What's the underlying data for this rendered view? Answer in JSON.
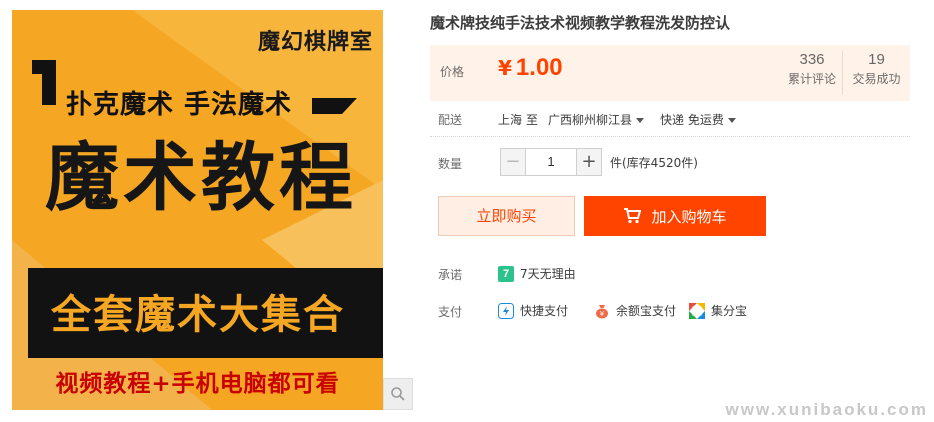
{
  "image": {
    "brand": "魔幻棋牌室",
    "headline_top": "扑克魔术  手法魔术",
    "headline_main": "魔术教程",
    "box_text": "全套魔术大集合",
    "bottom_text": "视频教程+手机电脑都可看",
    "zoom_icon": "magnifier-icon"
  },
  "product": {
    "title": "魔术牌技纯手法技术视频教学教程洗发防控认",
    "price_label": "价格",
    "currency": "¥",
    "price": "1.00",
    "reviews_count": "336",
    "reviews_label": "累计评论",
    "sold_count": "19",
    "sold_label": "交易成功"
  },
  "shipping": {
    "label": "配送",
    "from": "上海",
    "to_word": "至",
    "destination": "广西柳州柳江县",
    "method": "快递 免运费"
  },
  "quantity": {
    "label": "数量",
    "value": "1",
    "minus": "−",
    "plus": "+",
    "stock": "件(库存4520件)"
  },
  "actions": {
    "buy_now": "立即购买",
    "add_to_cart": "加入购物车"
  },
  "promise": {
    "label": "承诺",
    "badge": "7",
    "text": "7天无理由"
  },
  "payment": {
    "label": "支付",
    "methods": [
      "快捷支付",
      "余额宝支付",
      "集分宝"
    ]
  },
  "watermark": "www.xunibaoku.com",
  "colors": {
    "accent": "#ff4400",
    "price_bg": "#fff2e8",
    "image_bg": "#f5a623"
  }
}
